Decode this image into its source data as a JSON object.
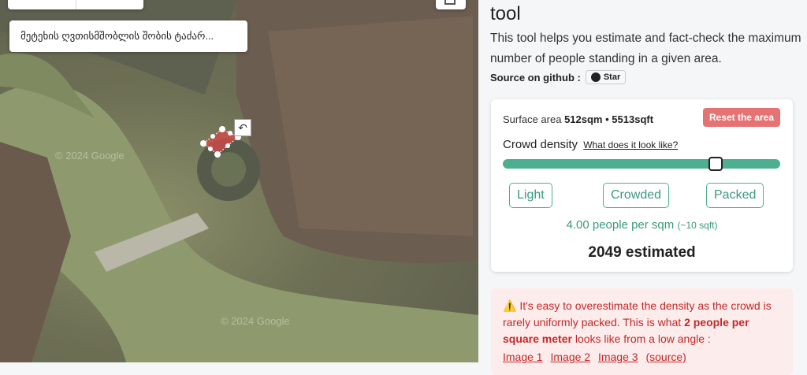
{
  "map": {
    "search_text": "მეტეხის ღვთისმშობლის შობის ტაძარ...",
    "watermark": "© 2024 Google"
  },
  "panel": {
    "title": "tool",
    "description": "This tool helps you estimate and fact-check the maximum number of people standing in a given area.",
    "source_label": "Source on github :",
    "star_label": "Star",
    "card": {
      "surface_prefix": "Surface area",
      "surface_sqm": "512sqm",
      "surface_sep": "•",
      "surface_sqft": "5513sqft",
      "reset_label": "Reset the area",
      "density_label": "Crowd density",
      "density_link": "What does it look like?",
      "slider_level": 0.78,
      "presets": [
        "Light",
        "Crowded",
        "Packed"
      ],
      "people_per_sqm": "4.00 people per sqm",
      "sqft_note": "(~10 sqft)",
      "estimate": "2049 estimated"
    },
    "warning": {
      "icon": "warning-icon",
      "text_before": "It's easy to overestimate the density as the crowd is rarely uniformly packed. This is what",
      "text_bold": "2 people per square meter",
      "text_after": "looks like from a low angle :",
      "links": [
        "Image 1",
        "Image 2",
        "Image 3",
        "(source)"
      ]
    }
  },
  "colors": {
    "accent": "#4caf90",
    "reset": "#e57373",
    "warning_text": "#c62828",
    "area": "#d94848"
  }
}
